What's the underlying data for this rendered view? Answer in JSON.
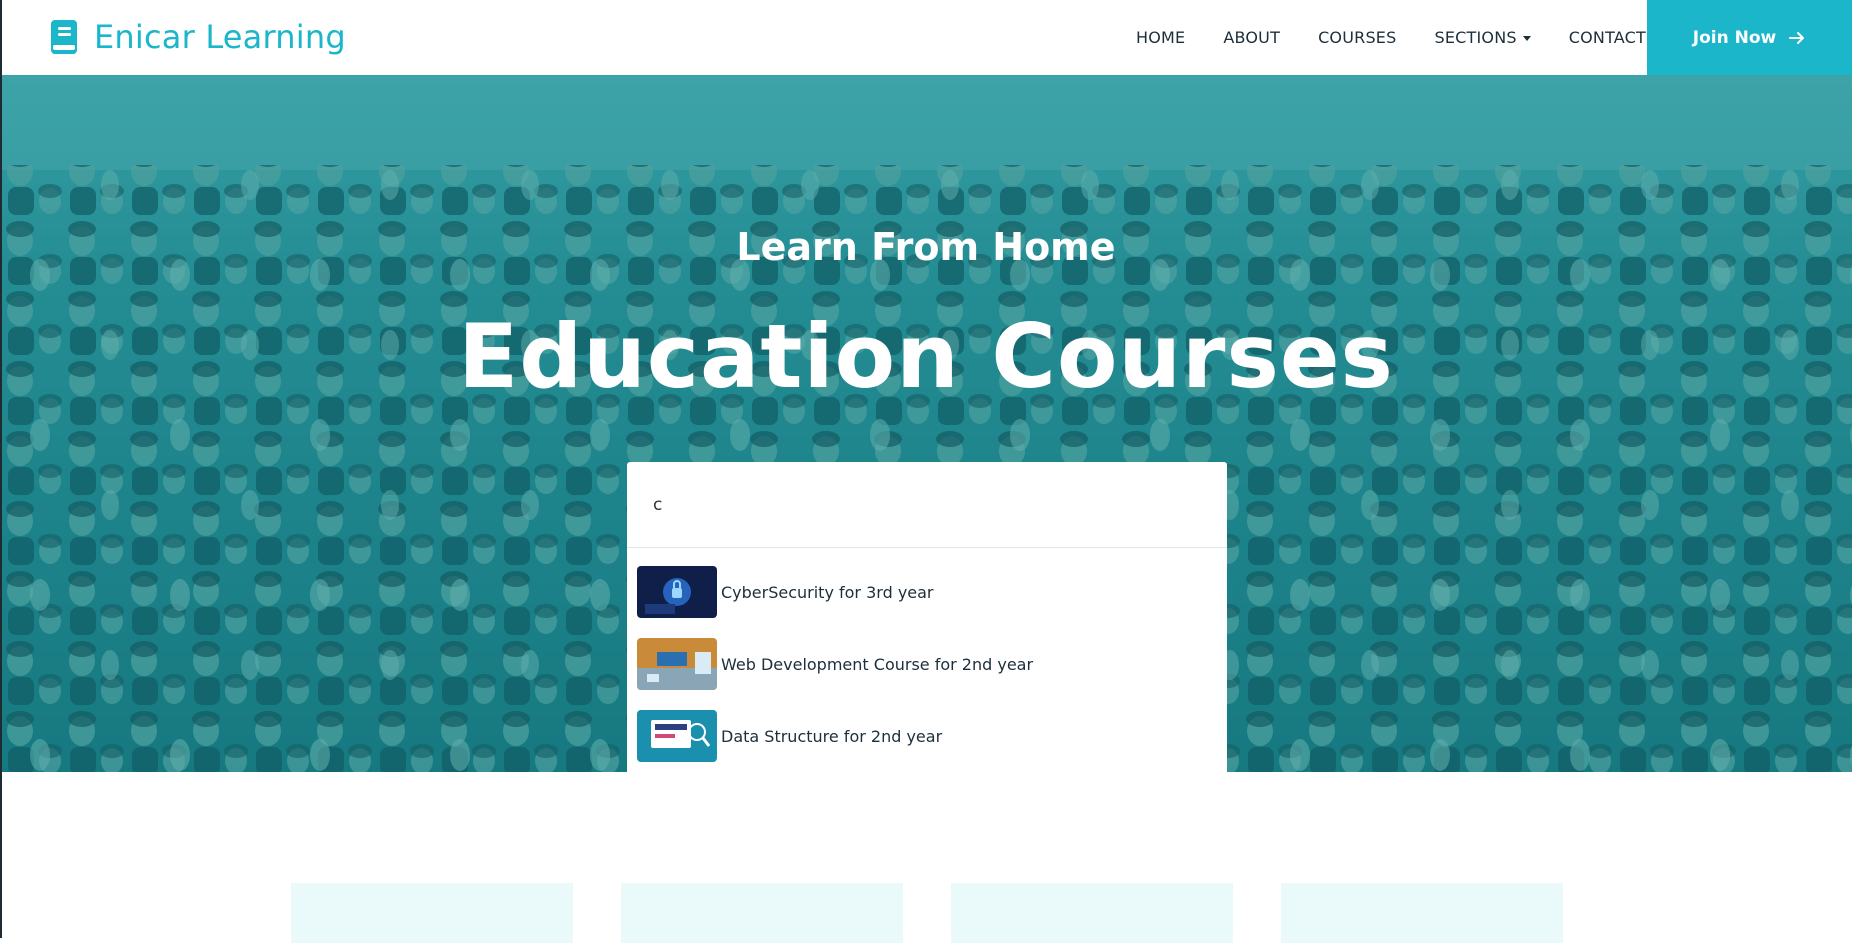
{
  "brand": {
    "name": "Enicar Learning",
    "accent": "#1bb6c9"
  },
  "nav": {
    "items": [
      "HOME",
      "ABOUT",
      "COURSES",
      "SECTIONS",
      "CONTACT"
    ],
    "join_label": "Join Now"
  },
  "hero": {
    "subtitle": "Learn From Home",
    "title": "Education Courses",
    "search": {
      "value": "c",
      "placeholder": ""
    },
    "results": [
      {
        "label": "CyberSecurity for 3rd year",
        "icon": "cybersecurity-thumbnail"
      },
      {
        "label": "Web Development Course for 2nd year",
        "icon": "html-thumbnail"
      },
      {
        "label": "Data Structure for 2nd year",
        "icon": "data-structure-thumbnail"
      }
    ]
  }
}
